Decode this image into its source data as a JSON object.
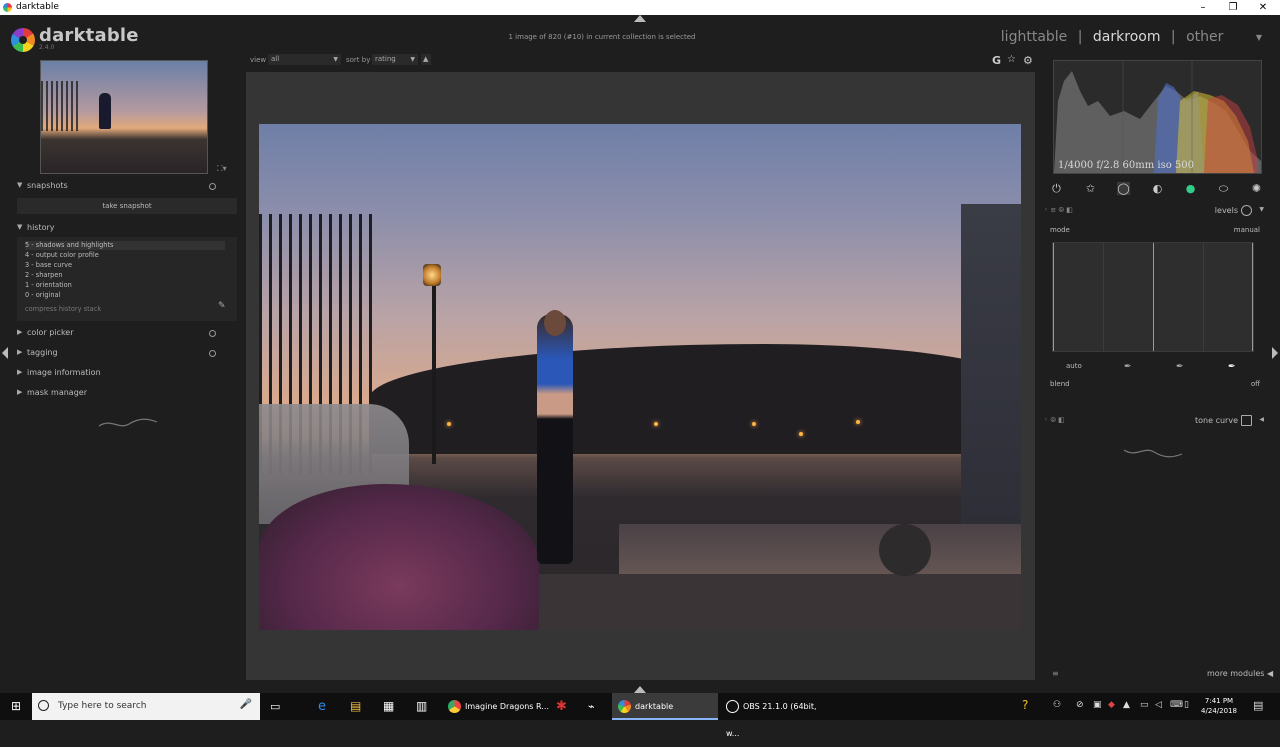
{
  "window": {
    "title": "darktable"
  },
  "app": {
    "logo_text": "darktable",
    "version": "2.4.0"
  },
  "header": {
    "collection_info": "1 image of 820 (#10) in current collection is selected",
    "views": {
      "lighttable": "lighttable",
      "sep1": "|",
      "darkroom": "darkroom",
      "sep2": "|",
      "other": "other"
    }
  },
  "toolbar": {
    "view_label": "view",
    "view_value": "all",
    "sortby_label": "sort by",
    "sortby_value": "rating",
    "g_icon": "G"
  },
  "left_panel": {
    "snapshots": {
      "label": "snapshots",
      "take_snapshot": "take snapshot"
    },
    "history": {
      "label": "history",
      "items": [
        "5 - shadows and highlights",
        "4 - output color profile",
        "3 - base curve",
        "2 - sharpen",
        "1 - orientation",
        "0 - original"
      ],
      "compress": "compress history stack"
    },
    "color_picker": "color picker",
    "tagging": "tagging",
    "image_information": "image information",
    "mask_manager": "mask manager"
  },
  "right_panel": {
    "exif": "1/4000 f/2.8 60mm iso 500",
    "levels": {
      "name": "levels",
      "mode_label": "mode",
      "mode_value": "manual",
      "auto_label": "auto",
      "blend_label": "blend",
      "blend_value": "off"
    },
    "tone_curve": {
      "name": "tone curve"
    },
    "more_modules": "more modules"
  },
  "taskbar": {
    "search_placeholder": "Type here to search",
    "apps": [
      {
        "label": "Imagine Dragons R...",
        "icon": "chrome-icon"
      },
      {
        "label": "darktable",
        "icon": "darktable-icon"
      },
      {
        "label": "OBS 21.1.0 (64bit, w...",
        "icon": "obs-icon"
      }
    ],
    "clock_time": "7:41 PM",
    "clock_date": "4/24/2018"
  },
  "colors": {
    "accent": "#8ab4f8",
    "panel_bg": "#1e1e1e",
    "center_bg": "#353535"
  }
}
